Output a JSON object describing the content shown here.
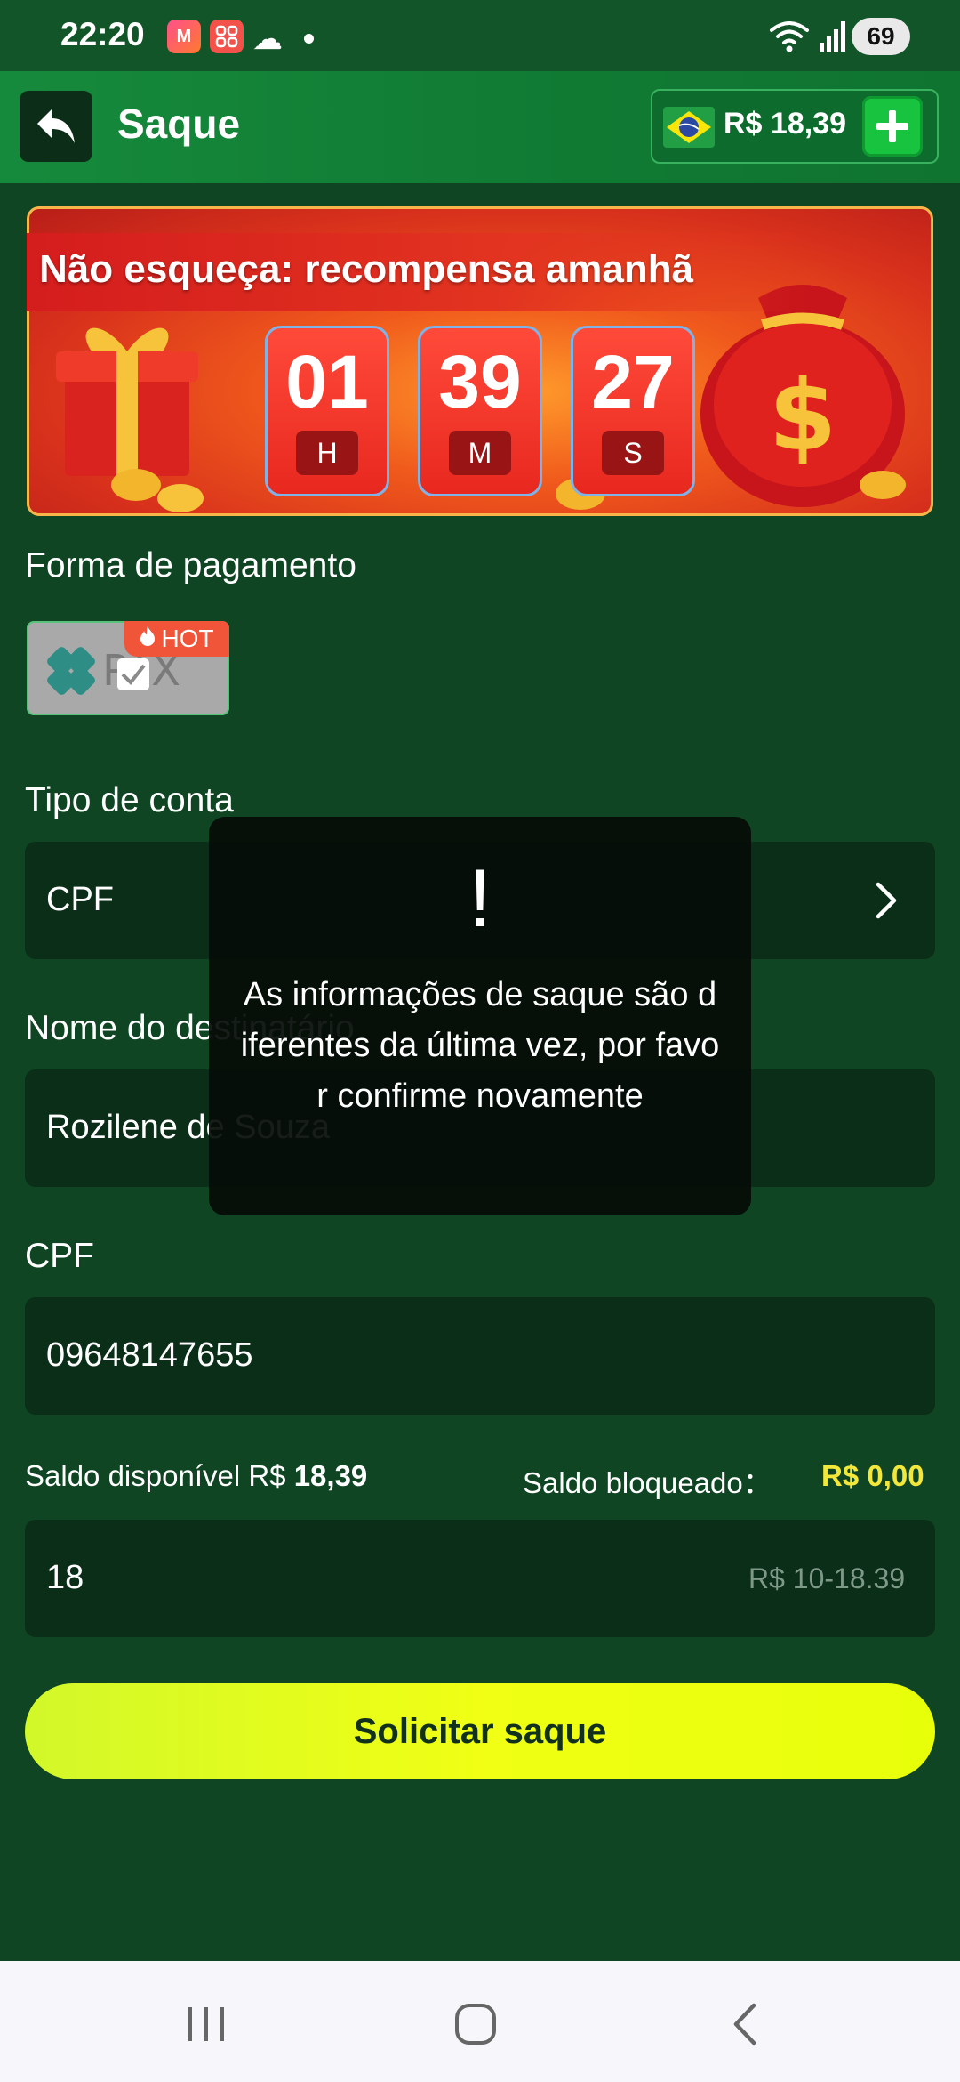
{
  "status_bar": {
    "time": "22:20",
    "battery": "69",
    "app_icons": [
      "app-icon-m",
      "app-icon-grid"
    ]
  },
  "header": {
    "title": "Saque",
    "balance": "R$ 18,39",
    "back_icon": "back-arrow-icon",
    "add_icon": "plus-icon",
    "flag_icon": "brazil-flag-icon"
  },
  "banner": {
    "text": "Não esqueça: recompensa amanhã",
    "countdown": [
      {
        "value": "01",
        "unit": "H"
      },
      {
        "value": "39",
        "unit": "M"
      },
      {
        "value": "27",
        "unit": "S"
      }
    ]
  },
  "payment": {
    "label": "Forma de pagamento",
    "method": "PIX",
    "badge": "HOT"
  },
  "account_type": {
    "label": "Tipo de conta",
    "value": "CPF"
  },
  "recipient": {
    "label": "Nome do destinatário",
    "value": "Rozilene de Souza"
  },
  "cpf": {
    "label": "CPF",
    "value": "09648147655"
  },
  "saldo": {
    "available_label": "Saldo disponível R$",
    "available_value": "18,39",
    "blocked_label": "Saldo bloqueado：",
    "blocked_value": "R$ 0,00"
  },
  "amount": {
    "value": "18",
    "hint": "R$ 10-18.39"
  },
  "submit_label": "Solicitar saque",
  "toast": {
    "icon": "!",
    "message": "As informações de saque são diferentes da última vez, por favor confirme novamente"
  },
  "colors": {
    "background": "#0f4523",
    "header": "#107a33",
    "accent_button": "#f0ff14",
    "blocked_value": "#f3e83a"
  }
}
